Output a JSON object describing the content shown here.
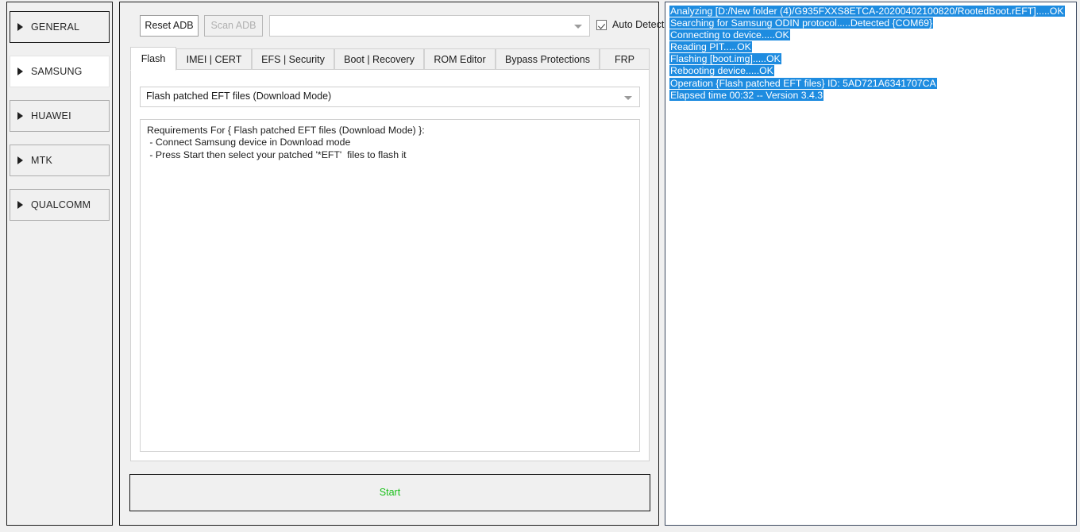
{
  "sidebar": {
    "items": [
      {
        "label": "GENERAL",
        "state": "focused",
        "icon": "triangle-right-icon"
      },
      {
        "label": "SAMSUNG",
        "state": "selected",
        "icon": "triangle-right-icon"
      },
      {
        "label": "HUAWEI",
        "state": "normal",
        "icon": "triangle-right-icon"
      },
      {
        "label": "MTK",
        "state": "normal",
        "icon": "triangle-right-icon"
      },
      {
        "label": "QUALCOMM",
        "state": "normal",
        "icon": "triangle-right-icon"
      }
    ]
  },
  "toolbar": {
    "reset_adb_label": "Reset ADB",
    "scan_adb_label": "Scan ADB",
    "device_combo_value": "",
    "device_combo_arrow": "chevron-down-icon",
    "auto_detect_label": "Auto Detect",
    "auto_detect_checked": true,
    "check_icon": "check-icon"
  },
  "tabs": [
    {
      "label": "Flash",
      "active": true
    },
    {
      "label": "IMEI | CERT",
      "active": false
    },
    {
      "label": "EFS | Security",
      "active": false
    },
    {
      "label": "Boot | Recovery",
      "active": false
    },
    {
      "label": "ROM Editor",
      "active": false
    },
    {
      "label": "Bypass Protections",
      "active": false
    },
    {
      "label": "FRP",
      "active": false
    }
  ],
  "content": {
    "operation_combo_value": "Flash patched EFT files (Download Mode)",
    "operation_combo_arrow": "chevron-down-icon",
    "requirements": [
      "Requirements For { Flash patched EFT files (Download Mode) }:",
      " - Connect Samsung device in Download mode",
      " - Press Start then select your patched '*EFT'  files to flash it"
    ]
  },
  "start_button": {
    "label": "Start",
    "text_color": "#18c018"
  },
  "log": {
    "highlight_color": "#1e8ce0",
    "lines": [
      "Analyzing [D:/New folder (4)/G935FXXS8ETCA-20200402100820/RootedBoot.rEFT].....OK",
      "Searching for Samsung ODIN protocol.....Detected {COM69}",
      "Connecting to device.....OK",
      "Reading PIT.....OK",
      "Flashing [boot.img].....OK",
      "Rebooting device.....OK",
      "Operation {Flash patched EFT files} ID: 5AD721A6341707CA",
      "Elapsed time 00:32 -- Version 3.4.3"
    ]
  }
}
